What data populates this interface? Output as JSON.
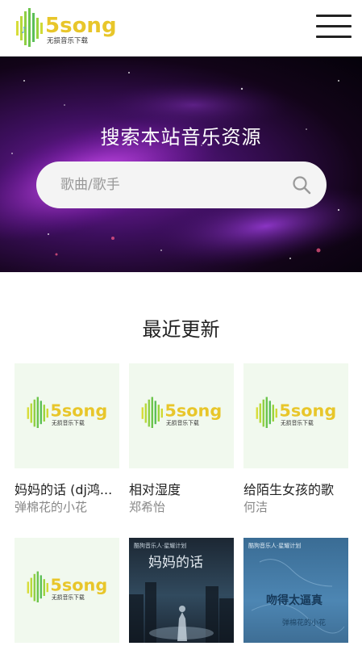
{
  "header": {
    "logo_text": "5song",
    "logo_tagline": "无损音乐下载"
  },
  "hero": {
    "title": "搜索本站音乐资源",
    "search_placeholder": "歌曲/歌手"
  },
  "section": {
    "title": "最近更新"
  },
  "songs": [
    {
      "title": "妈妈的话 (dj鸿...",
      "artist": "弹棉花的小花"
    },
    {
      "title": "相对湿度",
      "artist": "郑希怡"
    },
    {
      "title": "给陌生女孩的歌",
      "artist": "何洁"
    },
    {
      "title": "",
      "artist": ""
    },
    {
      "title": "",
      "artist": ""
    },
    {
      "title": "",
      "artist": ""
    }
  ],
  "covers": {
    "card5_top": "酷狗音乐人·星耀计划",
    "card5_main": "妈妈的话",
    "card6_top": "酷狗音乐人·星耀计划",
    "card6_main": "吻得太逼真",
    "card6_sub": "弹棉花的小花"
  },
  "colors": {
    "logo_green": "#7cc94a",
    "logo_yellow": "#e8c62a",
    "hero_purple": "#7a1fa8"
  }
}
